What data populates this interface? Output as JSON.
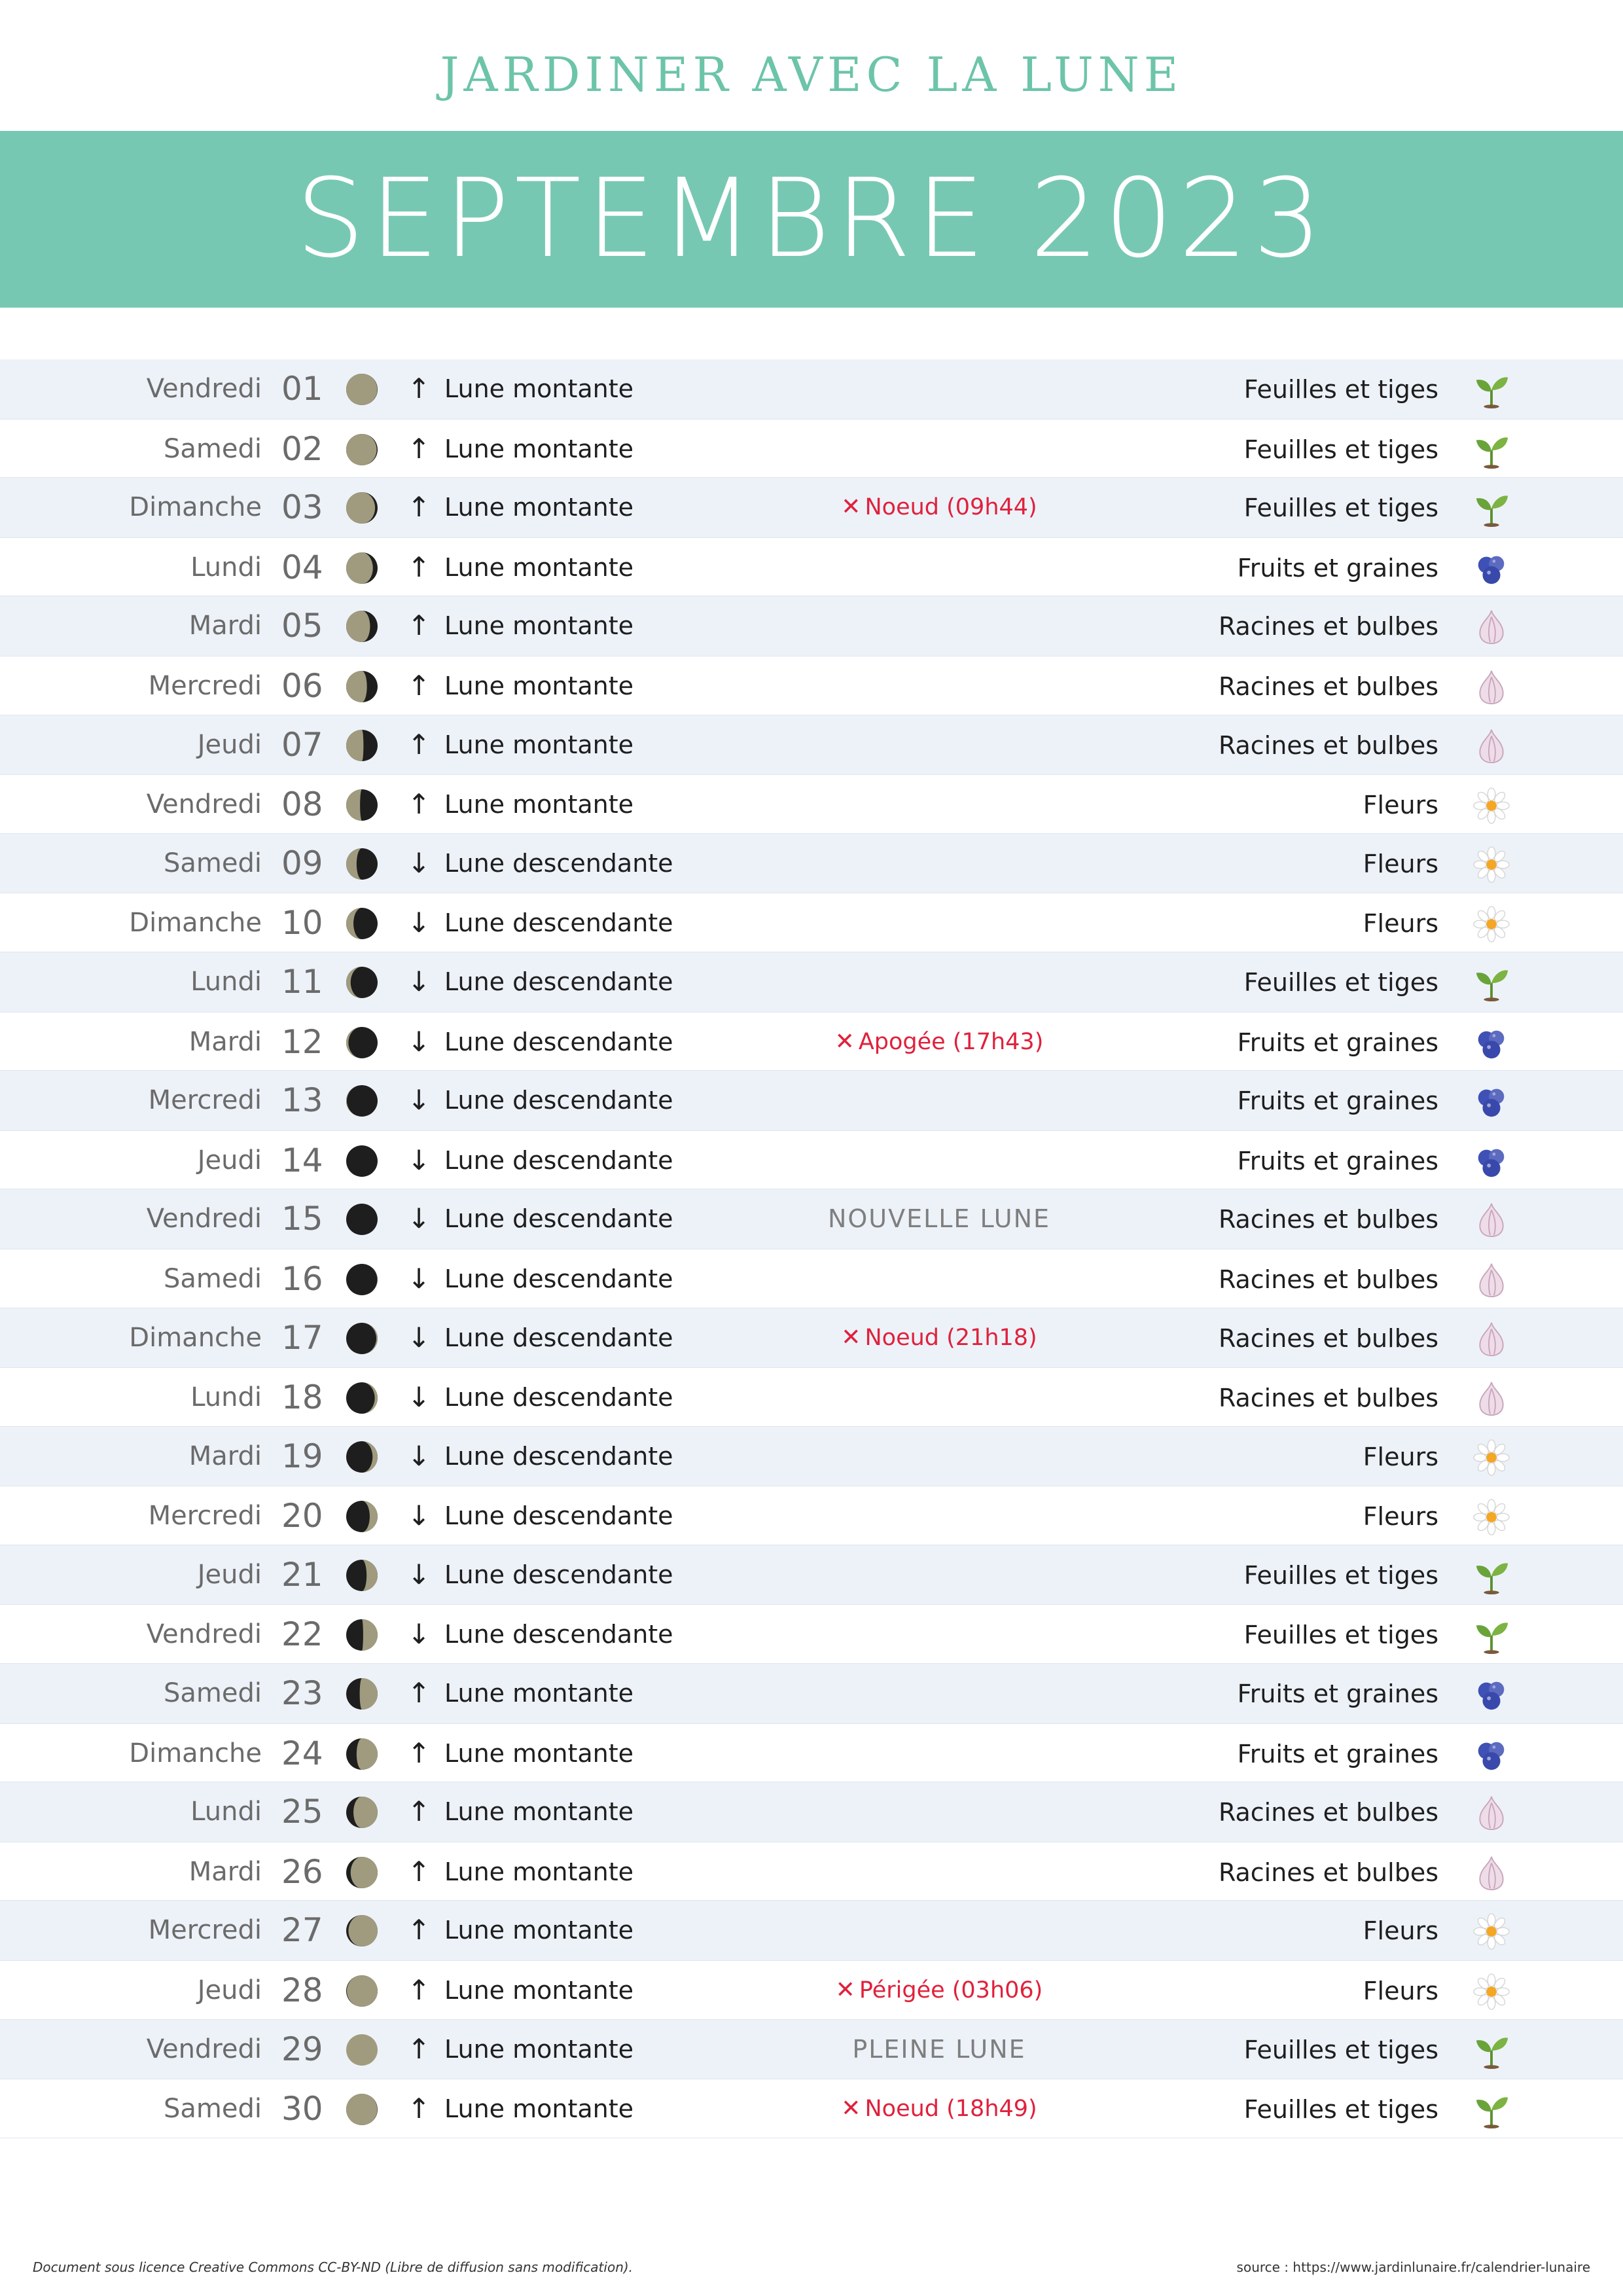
{
  "header": {
    "supertitle": "JARDINER AVEC LA LUNE",
    "title": "SEPTEMBRE 2023"
  },
  "colors": {
    "accent": "#77c8b2",
    "row_alt": "#edf2f9",
    "event_red": "#e0213c",
    "moon_lit": "#a09b7e",
    "moon_dark": "#1e1e1e"
  },
  "days": [
    {
      "day": "Vendredi",
      "num": "01",
      "illum": 0.99,
      "waxing": false,
      "arrow": "↑",
      "trend": "Lune montante",
      "event": "",
      "phase": "",
      "category": "Feuilles et tiges",
      "icon": "sprout-icon"
    },
    {
      "day": "Samedi",
      "num": "02",
      "illum": 0.97,
      "waxing": false,
      "arrow": "↑",
      "trend": "Lune montante",
      "event": "",
      "phase": "",
      "category": "Feuilles et tiges",
      "icon": "sprout-icon"
    },
    {
      "day": "Dimanche",
      "num": "03",
      "illum": 0.92,
      "waxing": false,
      "arrow": "↑",
      "trend": "Lune montante",
      "event": "Noeud (09h44)",
      "phase": "",
      "category": "Feuilles et tiges",
      "icon": "sprout-icon"
    },
    {
      "day": "Lundi",
      "num": "04",
      "illum": 0.85,
      "waxing": false,
      "arrow": "↑",
      "trend": "Lune montante",
      "event": "",
      "phase": "",
      "category": "Fruits et graines",
      "icon": "berries-icon"
    },
    {
      "day": "Mardi",
      "num": "05",
      "illum": 0.76,
      "waxing": false,
      "arrow": "↑",
      "trend": "Lune montante",
      "event": "",
      "phase": "",
      "category": "Racines et bulbes",
      "icon": "garlic-icon"
    },
    {
      "day": "Mercredi",
      "num": "06",
      "illum": 0.66,
      "waxing": false,
      "arrow": "↑",
      "trend": "Lune montante",
      "event": "",
      "phase": "",
      "category": "Racines et bulbes",
      "icon": "garlic-icon"
    },
    {
      "day": "Jeudi",
      "num": "07",
      "illum": 0.55,
      "waxing": false,
      "arrow": "↑",
      "trend": "Lune montante",
      "event": "",
      "phase": "",
      "category": "Racines et bulbes",
      "icon": "garlic-icon"
    },
    {
      "day": "Vendredi",
      "num": "08",
      "illum": 0.44,
      "waxing": false,
      "arrow": "↑",
      "trend": "Lune montante",
      "event": "",
      "phase": "",
      "category": "Fleurs",
      "icon": "daisy-icon"
    },
    {
      "day": "Samedi",
      "num": "09",
      "illum": 0.33,
      "waxing": false,
      "arrow": "↓",
      "trend": "Lune descendante",
      "event": "",
      "phase": "",
      "category": "Fleurs",
      "icon": "daisy-icon"
    },
    {
      "day": "Dimanche",
      "num": "10",
      "illum": 0.23,
      "waxing": false,
      "arrow": "↓",
      "trend": "Lune descendante",
      "event": "",
      "phase": "",
      "category": "Fleurs",
      "icon": "daisy-icon"
    },
    {
      "day": "Lundi",
      "num": "11",
      "illum": 0.14,
      "waxing": false,
      "arrow": "↓",
      "trend": "Lune descendante",
      "event": "",
      "phase": "",
      "category": "Feuilles et tiges",
      "icon": "sprout-icon"
    },
    {
      "day": "Mardi",
      "num": "12",
      "illum": 0.07,
      "waxing": false,
      "arrow": "↓",
      "trend": "Lune descendante",
      "event": "Apogée (17h43)",
      "phase": "",
      "category": "Fruits et graines",
      "icon": "berries-icon"
    },
    {
      "day": "Mercredi",
      "num": "13",
      "illum": 0.02,
      "waxing": false,
      "arrow": "↓",
      "trend": "Lune descendante",
      "event": "",
      "phase": "",
      "category": "Fruits et graines",
      "icon": "berries-icon"
    },
    {
      "day": "Jeudi",
      "num": "14",
      "illum": 0.0,
      "waxing": false,
      "arrow": "↓",
      "trend": "Lune descendante",
      "event": "",
      "phase": "",
      "category": "Fruits et graines",
      "icon": "berries-icon"
    },
    {
      "day": "Vendredi",
      "num": "15",
      "illum": 0.0,
      "waxing": true,
      "arrow": "↓",
      "trend": "Lune descendante",
      "event": "",
      "phase": "NOUVELLE LUNE",
      "category": "Racines et bulbes",
      "icon": "garlic-icon"
    },
    {
      "day": "Samedi",
      "num": "16",
      "illum": 0.01,
      "waxing": true,
      "arrow": "↓",
      "trend": "Lune descendante",
      "event": "",
      "phase": "",
      "category": "Racines et bulbes",
      "icon": "garlic-icon"
    },
    {
      "day": "Dimanche",
      "num": "17",
      "illum": 0.04,
      "waxing": true,
      "arrow": "↓",
      "trend": "Lune descendante",
      "event": "Noeud (21h18)",
      "phase": "",
      "category": "Racines et bulbes",
      "icon": "garlic-icon"
    },
    {
      "day": "Lundi",
      "num": "18",
      "illum": 0.09,
      "waxing": true,
      "arrow": "↓",
      "trend": "Lune descendante",
      "event": "",
      "phase": "",
      "category": "Racines et bulbes",
      "icon": "garlic-icon"
    },
    {
      "day": "Mardi",
      "num": "19",
      "illum": 0.16,
      "waxing": true,
      "arrow": "↓",
      "trend": "Lune descendante",
      "event": "",
      "phase": "",
      "category": "Fleurs",
      "icon": "daisy-icon"
    },
    {
      "day": "Mercredi",
      "num": "20",
      "illum": 0.25,
      "waxing": true,
      "arrow": "↓",
      "trend": "Lune descendante",
      "event": "",
      "phase": "",
      "category": "Fleurs",
      "icon": "daisy-icon"
    },
    {
      "day": "Jeudi",
      "num": "21",
      "illum": 0.35,
      "waxing": true,
      "arrow": "↓",
      "trend": "Lune descendante",
      "event": "",
      "phase": "",
      "category": "Feuilles et tiges",
      "icon": "sprout-icon"
    },
    {
      "day": "Vendredi",
      "num": "22",
      "illum": 0.46,
      "waxing": true,
      "arrow": "↓",
      "trend": "Lune descendante",
      "event": "",
      "phase": "",
      "category": "Feuilles et tiges",
      "icon": "sprout-icon"
    },
    {
      "day": "Samedi",
      "num": "23",
      "illum": 0.57,
      "waxing": true,
      "arrow": "↑",
      "trend": "Lune montante",
      "event": "",
      "phase": "",
      "category": "Fruits et graines",
      "icon": "berries-icon"
    },
    {
      "day": "Dimanche",
      "num": "24",
      "illum": 0.67,
      "waxing": true,
      "arrow": "↑",
      "trend": "Lune montante",
      "event": "",
      "phase": "",
      "category": "Fruits et graines",
      "icon": "berries-icon"
    },
    {
      "day": "Lundi",
      "num": "25",
      "illum": 0.77,
      "waxing": true,
      "arrow": "↑",
      "trend": "Lune montante",
      "event": "",
      "phase": "",
      "category": "Racines et bulbes",
      "icon": "garlic-icon"
    },
    {
      "day": "Mardi",
      "num": "26",
      "illum": 0.86,
      "waxing": true,
      "arrow": "↑",
      "trend": "Lune montante",
      "event": "",
      "phase": "",
      "category": "Racines et bulbes",
      "icon": "garlic-icon"
    },
    {
      "day": "Mercredi",
      "num": "27",
      "illum": 0.93,
      "waxing": true,
      "arrow": "↑",
      "trend": "Lune montante",
      "event": "",
      "phase": "",
      "category": "Fleurs",
      "icon": "daisy-icon"
    },
    {
      "day": "Jeudi",
      "num": "28",
      "illum": 0.98,
      "waxing": true,
      "arrow": "↑",
      "trend": "Lune montante",
      "event": "Périgée (03h06)",
      "phase": "",
      "category": "Fleurs",
      "icon": "daisy-icon"
    },
    {
      "day": "Vendredi",
      "num": "29",
      "illum": 1.0,
      "waxing": true,
      "arrow": "↑",
      "trend": "Lune montante",
      "event": "",
      "phase": "PLEINE LUNE",
      "category": "Feuilles et tiges",
      "icon": "sprout-icon"
    },
    {
      "day": "Samedi",
      "num": "30",
      "illum": 0.99,
      "waxing": false,
      "arrow": "↑",
      "trend": "Lune montante",
      "event": "Noeud (18h49)",
      "phase": "",
      "category": "Feuilles et tiges",
      "icon": "sprout-icon"
    }
  ],
  "footer": {
    "license": "Document sous licence Creative Commons CC-BY-ND (Libre de diffusion sans modification).",
    "source": "source : https://www.jardinlunaire.fr/calendrier-lunaire"
  }
}
